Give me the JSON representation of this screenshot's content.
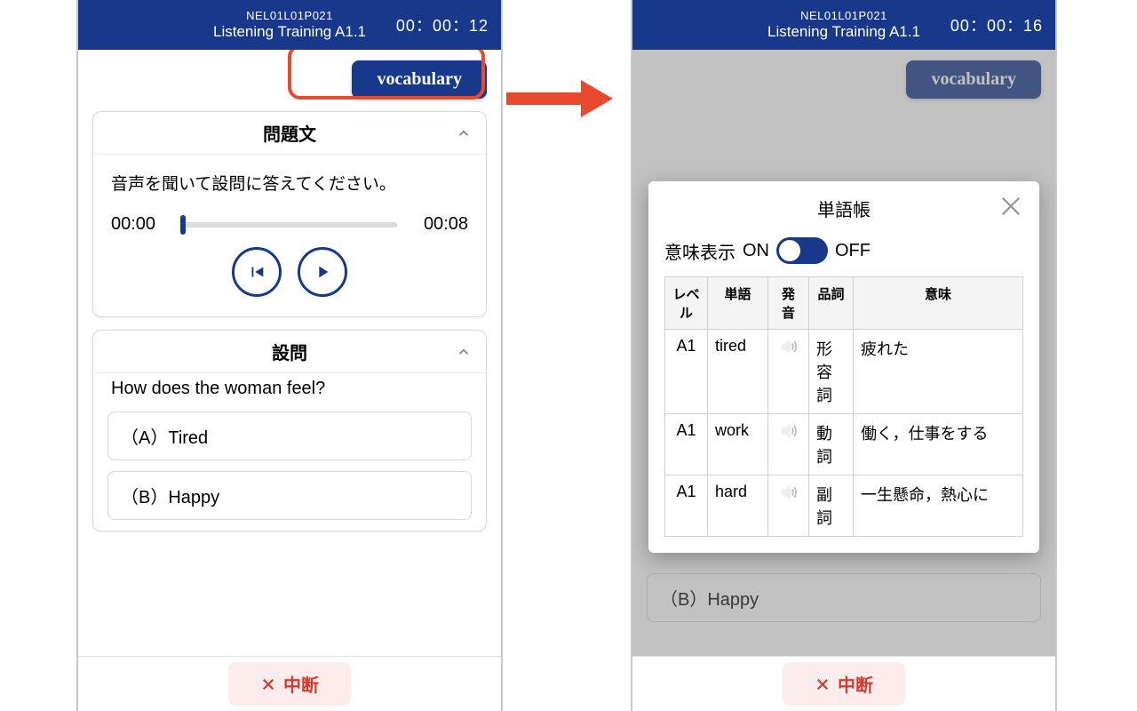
{
  "left": {
    "header": {
      "code": "NEL01L01P021",
      "title": "Listening Training A1.1",
      "timer": "00：00：12"
    },
    "vocab_button": "vocabulary",
    "question_card": {
      "heading": "問題文",
      "instruction": "音声を聞いて設問に答えてください。",
      "audio": {
        "current": "00:00",
        "total": "00:08"
      }
    },
    "answer_card": {
      "heading": "設問",
      "question": "How does the woman feel?",
      "choices": [
        "（A）Tired",
        "（B）Happy"
      ]
    },
    "suspend": "中断"
  },
  "right": {
    "header": {
      "code": "NEL01L01P021",
      "title": "Listening Training A1.1",
      "timer": "00：00：16"
    },
    "vocab_button": "vocabulary",
    "answer_card": {
      "choice_b": "（B）Happy"
    },
    "suspend": "中断",
    "modal": {
      "title": "単語帳",
      "toggle": {
        "label": "意味表示",
        "on": "ON",
        "off": "OFF"
      },
      "columns": {
        "level": "レベル",
        "word": "単語",
        "pron": "発音",
        "pos": "品詞",
        "meaning": "意味"
      },
      "rows": [
        {
          "level": "A1",
          "word": "tired",
          "pos": "形容詞",
          "meaning": "疲れた"
        },
        {
          "level": "A1",
          "word": "work",
          "pos": "動詞",
          "meaning": "働く，仕事をする"
        },
        {
          "level": "A1",
          "word": "hard",
          "pos": "副詞",
          "meaning": "一生懸命，熱心に"
        }
      ]
    }
  }
}
